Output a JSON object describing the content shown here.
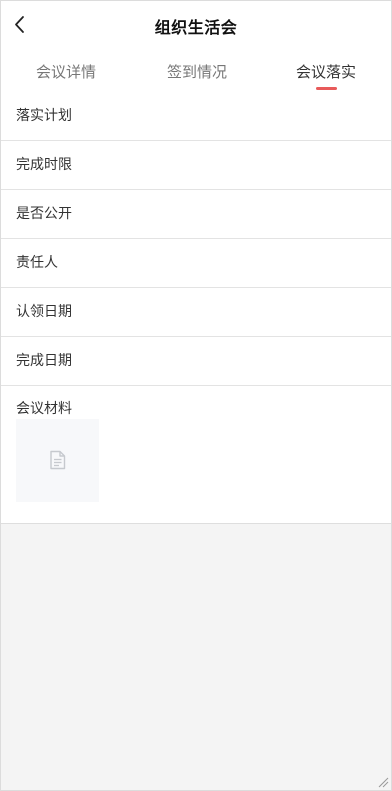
{
  "header": {
    "title": "组织生活会",
    "back_icon": "chevron-left-icon"
  },
  "tabs": [
    {
      "label": "会议详情",
      "active": false
    },
    {
      "label": "签到情况",
      "active": false
    },
    {
      "label": "会议落实",
      "active": true
    }
  ],
  "colors": {
    "accent": "#e85a5a",
    "background": "#f4f4f4",
    "card": "#ffffff"
  },
  "fields": [
    {
      "label": "落实计划"
    },
    {
      "label": "完成时限"
    },
    {
      "label": "是否公开"
    },
    {
      "label": "责任人"
    },
    {
      "label": "认领日期"
    },
    {
      "label": "完成日期"
    }
  ],
  "materials": {
    "label": "会议材料",
    "file_icon": "document-icon"
  }
}
